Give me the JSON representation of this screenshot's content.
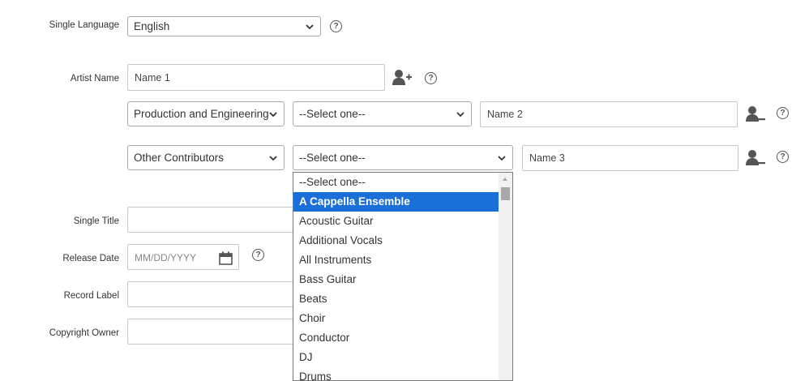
{
  "form": {
    "single_language": {
      "label": "Single Language",
      "value": "English"
    },
    "artist_name": {
      "label": "Artist Name",
      "value": "Name 1"
    },
    "contributor_rows": [
      {
        "role_category": "Production and Engineering",
        "role": "--Select one--",
        "name": "Name 2"
      },
      {
        "role_category": "Other Contributors",
        "role": "--Select one--",
        "name": "Name 3"
      }
    ],
    "single_title": {
      "label": "Single Title",
      "value": ""
    },
    "release_date": {
      "label": "Release Date",
      "placeholder": "MM/DD/YYYY"
    },
    "record_label": {
      "label": "Record Label",
      "value": ""
    },
    "copyright_owner": {
      "label": "Copyright Owner",
      "value": ""
    },
    "help_glyph": "?"
  },
  "dropdown": {
    "options": [
      "--Select one--",
      "A Cappella Ensemble",
      "Acoustic Guitar",
      "Additional Vocals",
      "All Instruments",
      "Bass Guitar",
      "Beats",
      "Choir",
      "Conductor",
      "DJ",
      "Drums"
    ],
    "highlighted_index": 1
  },
  "icons": {
    "add_contributor": "add-user-icon",
    "remove_contributor": "remove-user-icon",
    "help": "help-icon",
    "calendar": "calendar-icon",
    "chevron": "chevron-down-icon"
  },
  "colors": {
    "highlight": "#1a6fd8"
  }
}
